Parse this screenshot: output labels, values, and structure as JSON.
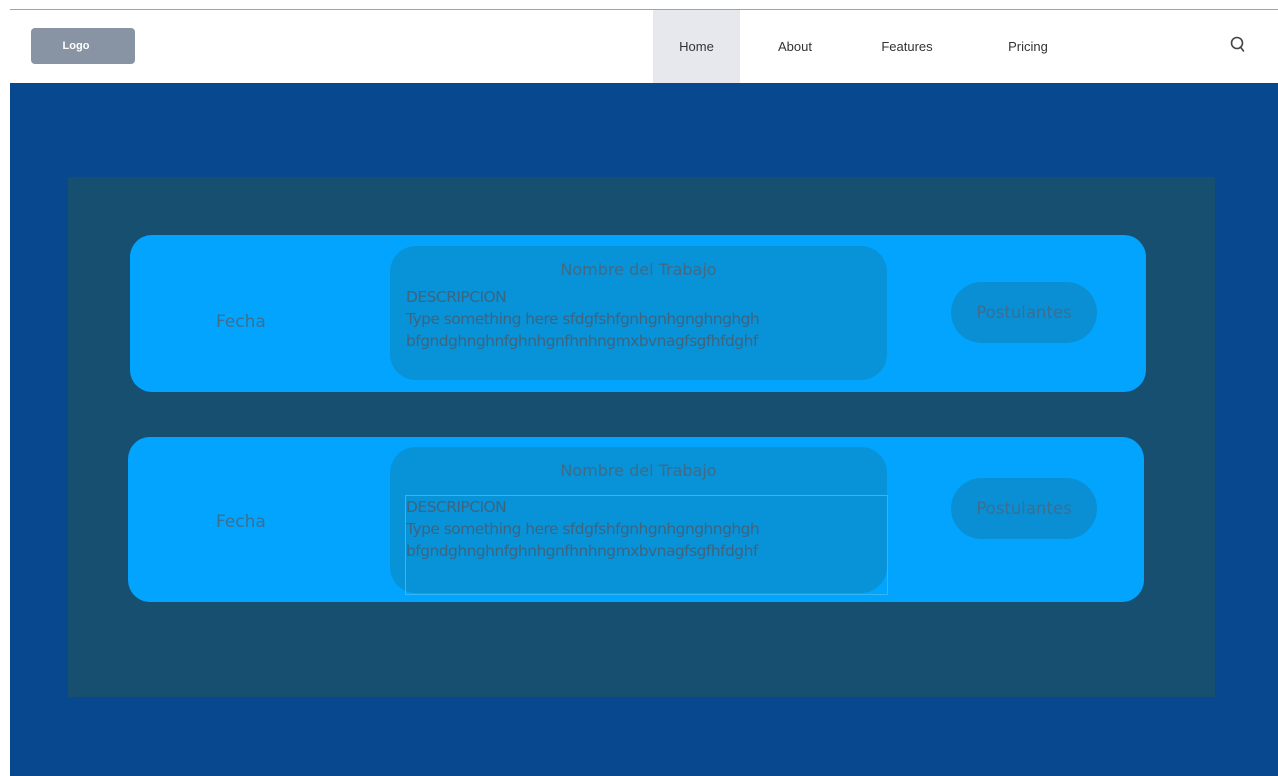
{
  "navbar": {
    "logo": "Logo",
    "items": [
      {
        "label": "Home",
        "active": true
      },
      {
        "label": "About",
        "active": false
      },
      {
        "label": "Features",
        "active": false
      },
      {
        "label": "Pricing",
        "active": false
      }
    ],
    "search_icon": "search-icon"
  },
  "jobs": [
    {
      "date": "Fecha",
      "title": "Nombre del Trabajo",
      "description_heading": "DESCRIPCION",
      "description_line1": "Type something here sfdgfshfgnhgnhgnghnghgh",
      "description_line2": "bfgndghnghnfghnhgnfhnhngmxbvnagfsgfhfdghf",
      "button": "Postulantes"
    },
    {
      "date": "Fecha",
      "title": "Nombre del Trabajo",
      "description_heading": "DESCRIPCION",
      "description_line1": "Type something here sfdgfshfgnhgnhgnghnghgh",
      "description_line2": "bfgndghnghnfghnhgnfhnhngmxbvnagfsgfhfdghf",
      "button": "Postulantes"
    }
  ],
  "colors": {
    "hero": "#07488e",
    "panel": "#174f70",
    "card": "#02a4fe",
    "nav_active": "#e6e8ee"
  }
}
